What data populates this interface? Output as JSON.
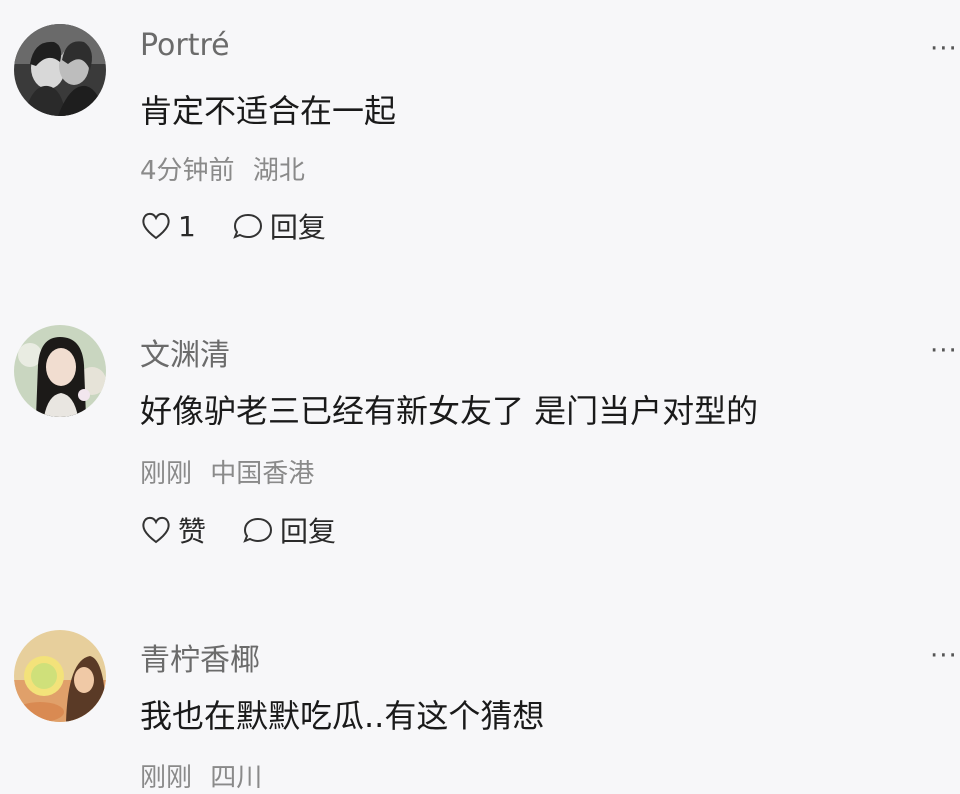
{
  "comments": [
    {
      "username": "Portré",
      "text": "肯定不适合在一起",
      "time": "4分钟前",
      "location": "湖北",
      "like_label": "1",
      "reply_label": "回复",
      "more": "···"
    },
    {
      "username": "文渊清",
      "text": "好像驴老三已经有新女友了 是门当户对型的",
      "time": "刚刚",
      "location": "中国香港",
      "like_label": "赞",
      "reply_label": "回复",
      "more": "···"
    },
    {
      "username": "青柠香椰",
      "text": "我也在默默吃瓜..有这个猜想",
      "time": "刚刚",
      "location": "四川",
      "more": "···"
    }
  ],
  "icons": {
    "like": "heart-outline-icon",
    "reply": "speech-bubble-icon",
    "more": "more-dots-icon"
  },
  "colors": {
    "background": "#f7f7f9",
    "username": "#6b6b6b",
    "text": "#1a1a1a",
    "meta": "#8a8a8a"
  }
}
